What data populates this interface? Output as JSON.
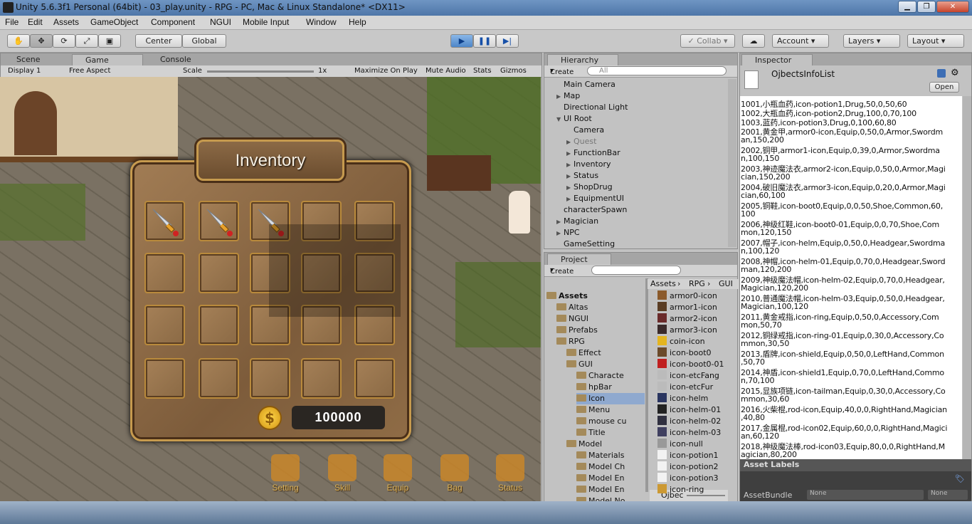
{
  "window": {
    "title": "Unity 5.6.3f1 Personal (64bit) - 03_play.unity - RPG - PC, Mac & Linux Standalone* <DX11>"
  },
  "menu": [
    "File",
    "Edit",
    "Assets",
    "GameObject",
    "Component",
    "NGUI",
    "Mobile Input",
    "Window",
    "Help"
  ],
  "toolbar": {
    "center": "Center",
    "global": "Global",
    "collab": "Collab",
    "account": "Account",
    "layers": "Layers",
    "layout": "Layout"
  },
  "scene_tabs": {
    "scene": "Scene",
    "game": "Game",
    "console": "Console"
  },
  "game_bar": {
    "display": "Display 1",
    "aspect": "Free Aspect",
    "scale_label": "Scale",
    "scale_value": "1x",
    "maximize": "Maximize On Play",
    "mute": "Mute Audio",
    "stats": "Stats",
    "gizmos": "Gizmos"
  },
  "inventory": {
    "title": "Inventory",
    "coins": "100000",
    "filled_slots": 3
  },
  "function_bar": [
    "Setting",
    "Skill",
    "Equip",
    "Bag",
    "Status"
  ],
  "hierarchy": {
    "tab": "Hierarchy",
    "create": "Create",
    "search": "All",
    "items": [
      {
        "label": "Main Camera",
        "indent": 0,
        "arrow": false
      },
      {
        "label": "Map",
        "indent": 0,
        "arrow": true
      },
      {
        "label": "Directional Light",
        "indent": 0,
        "arrow": false
      },
      {
        "label": "UI Root",
        "indent": 0,
        "arrow": true,
        "open": true
      },
      {
        "label": "Camera",
        "indent": 1,
        "arrow": false
      },
      {
        "label": "Quest",
        "indent": 1,
        "arrow": true,
        "dim": true
      },
      {
        "label": "FunctionBar",
        "indent": 1,
        "arrow": true
      },
      {
        "label": "Inventory",
        "indent": 1,
        "arrow": true
      },
      {
        "label": "Status",
        "indent": 1,
        "arrow": true
      },
      {
        "label": "ShopDrug",
        "indent": 1,
        "arrow": true
      },
      {
        "label": "EquipmentUI",
        "indent": 1,
        "arrow": true
      },
      {
        "label": "characterSpawn",
        "indent": 0,
        "arrow": false
      },
      {
        "label": "Magician",
        "indent": 0,
        "arrow": true
      },
      {
        "label": "NPC",
        "indent": 0,
        "arrow": true
      },
      {
        "label": "GameSetting",
        "indent": 0,
        "arrow": false
      }
    ]
  },
  "project": {
    "tab": "Project",
    "create": "Create",
    "folders": [
      {
        "label": "Assets",
        "level": 0,
        "bold": true
      },
      {
        "label": "Altas",
        "level": 1
      },
      {
        "label": "NGUI",
        "level": 1
      },
      {
        "label": "Prefabs",
        "level": 1
      },
      {
        "label": "RPG",
        "level": 1
      },
      {
        "label": "Effect",
        "level": 2
      },
      {
        "label": "GUI",
        "level": 2
      },
      {
        "label": "Characte",
        "level": 3
      },
      {
        "label": "hpBar",
        "level": 3
      },
      {
        "label": "Icon",
        "level": 3,
        "selected": true
      },
      {
        "label": "Menu",
        "level": 3
      },
      {
        "label": "mouse cu",
        "level": 3
      },
      {
        "label": "Title",
        "level": 3
      },
      {
        "label": "Model",
        "level": 2
      },
      {
        "label": "Materials",
        "level": 3
      },
      {
        "label": "Model Ch",
        "level": 3
      },
      {
        "label": "Model En",
        "level": 3
      },
      {
        "label": "Model En",
        "level": 3
      },
      {
        "label": "Model No",
        "level": 3
      }
    ],
    "breadcrumb": [
      "Assets",
      "RPG",
      "GUI"
    ],
    "assets": [
      "armor0-icon",
      "armor1-icon",
      "armor2-icon",
      "armor3-icon",
      "coin-icon",
      "icon-boot0",
      "icon-boot0-01",
      "icon-etcFang",
      "icon-etcFur",
      "icon-helm",
      "icon-helm-01",
      "icon-helm-02",
      "icon-helm-03",
      "icon-null",
      "icon-potion1",
      "icon-potion2",
      "icon-potion3",
      "icon-ring"
    ],
    "footer": "Ojbec"
  },
  "inspector": {
    "tab": "Inspector",
    "object": "OjbectsInfoList",
    "open": "Open",
    "lines": [
      "1001,小瓶血药,icon-potion1,Drug,50,0,50,60",
      "1002,大瓶血药,icon-potion2,Drug,100,0,70,100",
      "1003,蓝药,icon-potion3,Drug,0,100,60,80",
      "2001,黄金甲,armor0-icon,Equip,0,50,0,Armor,Swordm",
      "an,150,200",
      "2002,铜甲,armor1-icon,Equip,0,39,0,Armor,Swordma",
      "n,100,150",
      "2003,神迹魔法衣,armor2-icon,Equip,0,50,0,Armor,Magi",
      "cian,150,200",
      "2004,破旧魔法衣,armor3-icon,Equip,0,20,0,Armor,Magi",
      "cian,60,100",
      "2005,铜鞋,icon-boot0,Equip,0,0,50,Shoe,Common,60,",
      "100",
      "2006,神级红鞋,icon-boot0-01,Equip,0,0,70,Shoe,Com",
      "mon,120,150",
      "2007,帽子,icon-helm,Equip,0,50,0,Headgear,Swordma",
      "n,100,120",
      "2008,神帽,icon-helm-01,Equip,0,70,0,Headgear,Sword",
      "man,120,200",
      "2009,神级魔法帽,icon-helm-02,Equip,0,70,0,Headgear,",
      "Magician,120,200",
      "2010,普通魔法帽,icon-helm-03,Equip,0,50,0,Headgear,",
      "Magician,100,120",
      "2011,黄金戒指,icon-ring,Equip,0,50,0,Accessory,Com",
      "mon,50,70",
      "2012,铜绿戒指,icon-ring-01,Equip,0,30,0,Accessory,Co",
      "mmon,30,50",
      "2013,盾牌,icon-shield,Equip,0,50,0,LeftHand,Common",
      ",50,70",
      "2014,神盾,icon-shield1,Equip,0,70,0,LeftHand,Commo",
      "n,70,100",
      "2015,显族项链,icon-tailman,Equip,0,30,0,Accessory,Co",
      "mmon,30,60",
      "2016,火柴棍,rod-icon,Equip,40,0,0,RightHand,Magician",
      ",40,80",
      "2017,金属棍,rod-icon02,Equip,60,0,0,RightHand,Magici",
      "an,60,120",
      "2018,神级魔法棒,rod-icon03,Equip,80,0,0,RightHand,M",
      "agician,80,200"
    ],
    "asset_labels": "Asset Labels",
    "asset_bundle": "AssetBundle",
    "bundle_value": "None",
    "variant_value": "None"
  }
}
